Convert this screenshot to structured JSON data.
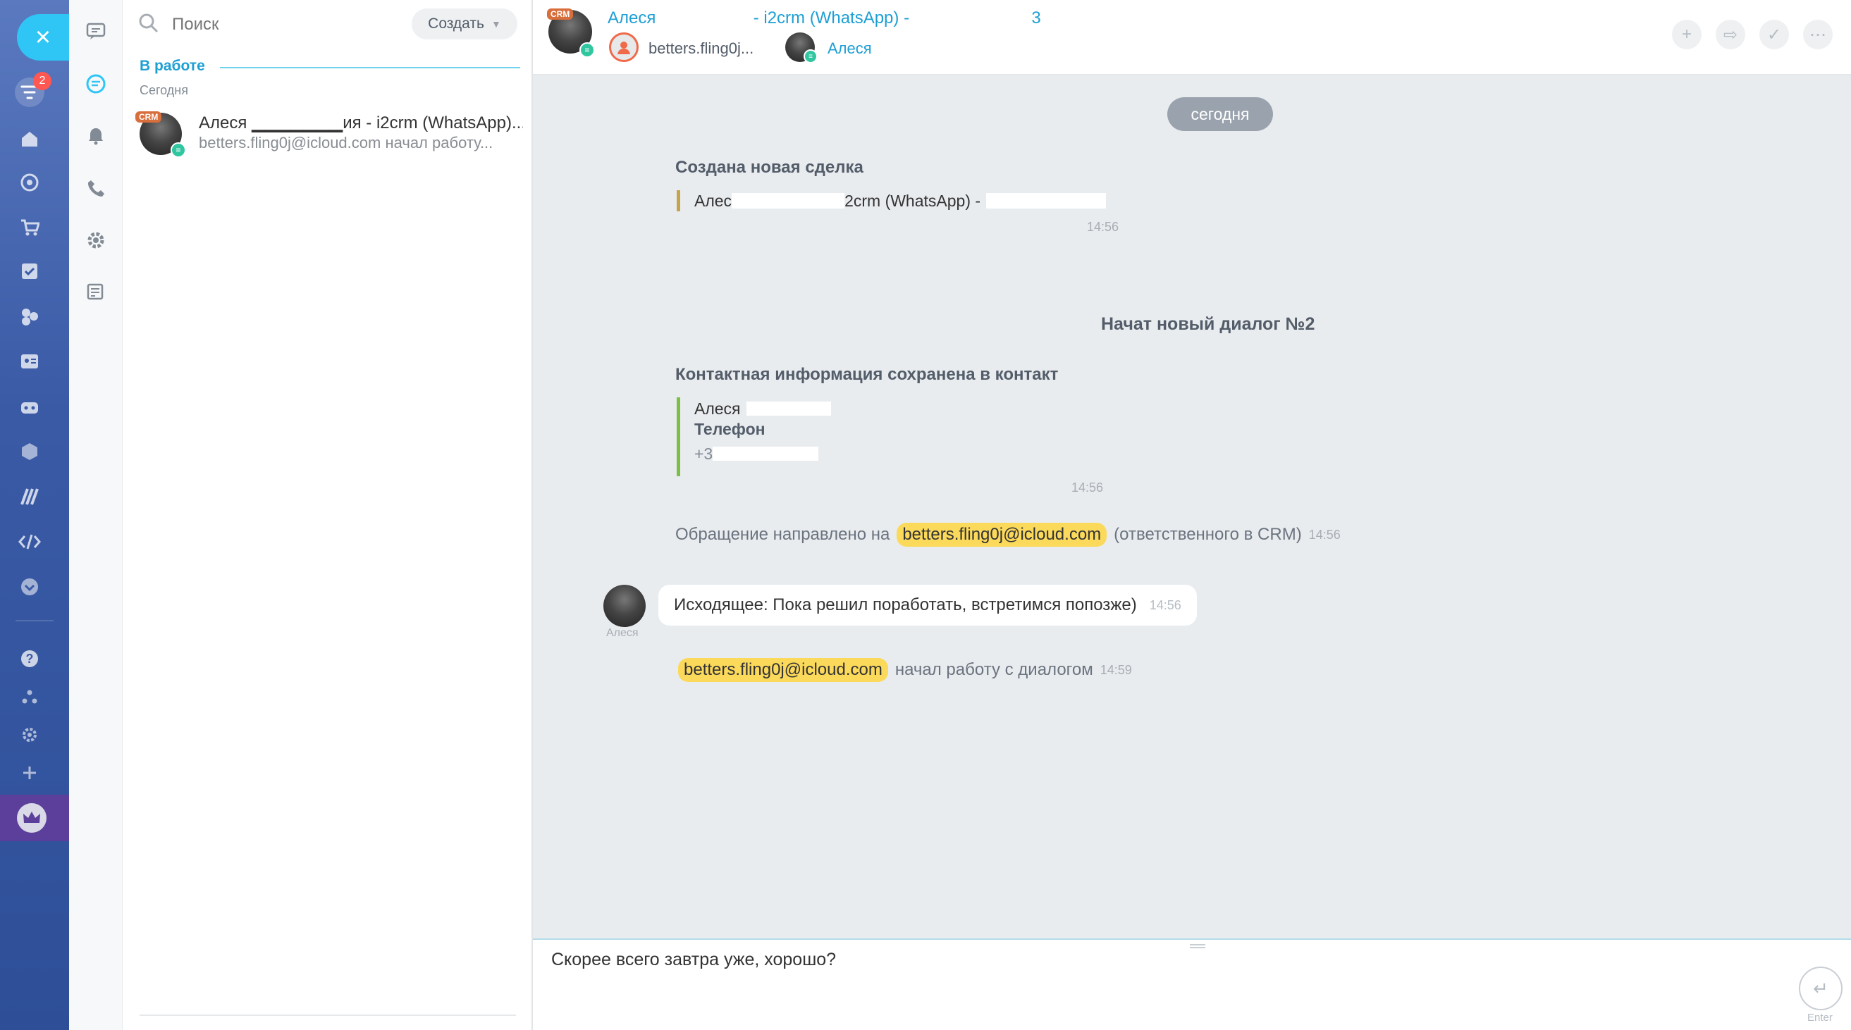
{
  "leftnav": {
    "close_icon": "×",
    "notifications_badge": "2"
  },
  "list": {
    "search_placeholder": "Поиск",
    "create_label": "Создать",
    "section_label": "В работе",
    "date_label": "Сегодня",
    "items": [
      {
        "name": "Алеся ▁▁▁▁▁▁▁ия - i2crm (WhatsApp)...",
        "preview": "betters.fling0j@icloud.com начал работу...",
        "crm_tag": "CRM"
      }
    ]
  },
  "header": {
    "title_name": "Алеся",
    "title_rest": " - i2crm (WhatsApp) -",
    "title_tail": "3",
    "crm_tag": "CRM",
    "participant_1": "betters.fling0j...",
    "participant_2": "Алеся"
  },
  "messages": {
    "date_pill": "сегодня",
    "deal_title": "Создана новая сделка",
    "deal_quote_start": "Алес",
    "deal_quote_end": "2crm (WhatsApp) -",
    "deal_time": "14:56",
    "dialog_title": "Начат новый диалог №2",
    "contact_title": "Контактная информация сохранена в контакт",
    "contact_name": "Алеся",
    "contact_phone_label": "Телефон",
    "contact_phone_value": "+3",
    "contact_time": "14:56",
    "routed_prefix": "Обращение направлено на",
    "routed_email": "betters.fling0j@icloud.com",
    "routed_suffix": "(ответственного в CRM)",
    "routed_time": "14:56",
    "outgoing_author": "Алеся",
    "outgoing_text": "Исходящее: Пока решил поработать, встретимся попозже)",
    "outgoing_time": "14:56",
    "started_email": "betters.fling0j@icloud.com",
    "started_suffix": "начал работу с диалогом",
    "started_time": "14:59"
  },
  "composer": {
    "text": "Скорее всего завтра уже, хорошо?",
    "send_hint": "Enter"
  },
  "colors": {
    "accent": "#2fc6f6",
    "link": "#1e9fd4",
    "highlight": "#fbd95a",
    "nav_bg": "#3a5aa6"
  }
}
